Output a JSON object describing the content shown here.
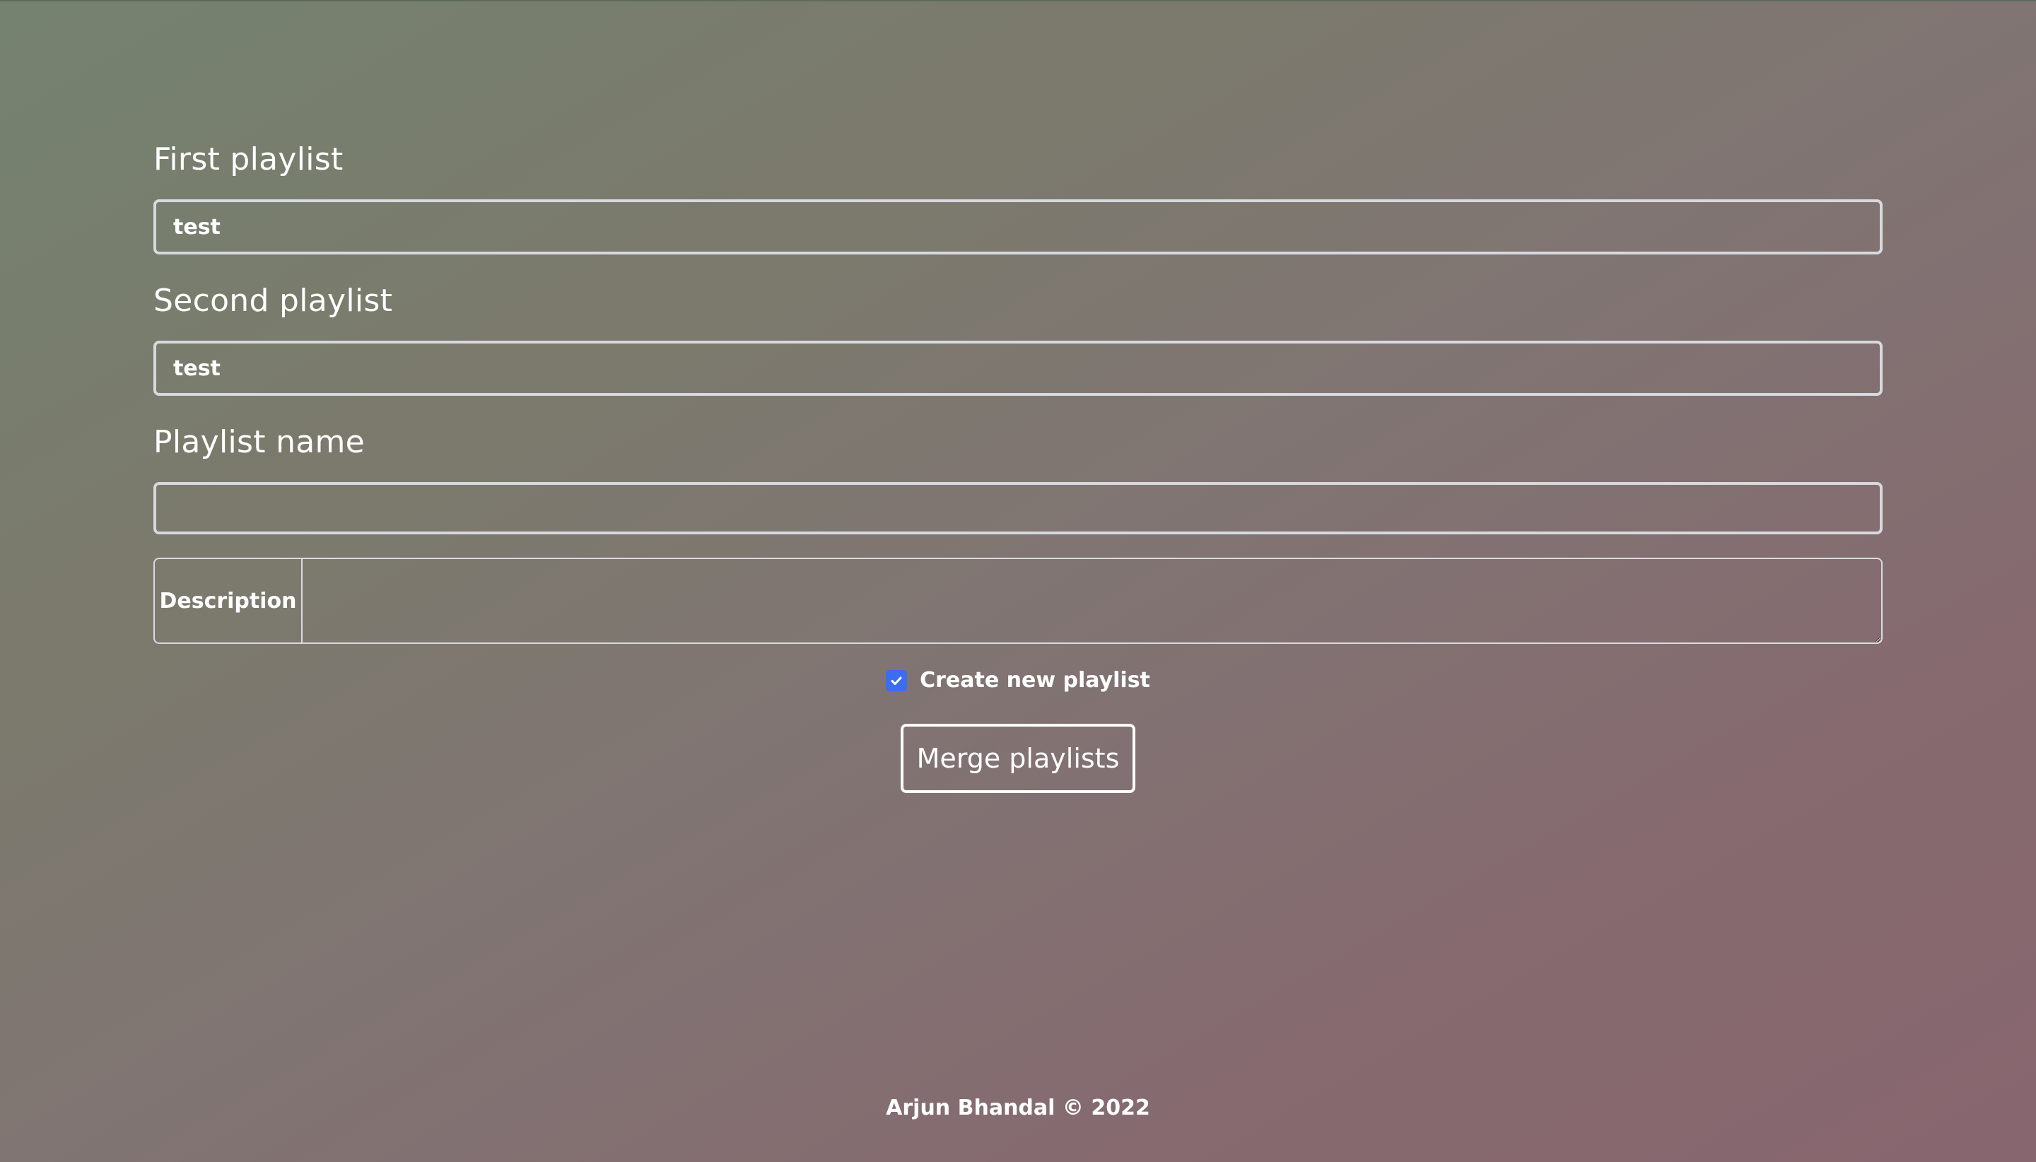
{
  "form": {
    "first_playlist": {
      "label": "First playlist",
      "value": "test"
    },
    "second_playlist": {
      "label": "Second playlist",
      "value": "test"
    },
    "playlist_name": {
      "label": "Playlist name",
      "value": ""
    },
    "description": {
      "label": "Description",
      "value": ""
    },
    "create_new_playlist": {
      "label": "Create new playlist",
      "checked": true
    },
    "merge_button_label": "Merge playlists"
  },
  "footer": {
    "text": "Arjun Bhandal © 2022"
  },
  "colors": {
    "checkbox_accent": "#3a6df0",
    "input_border": "#d7d9df"
  },
  "icons": {
    "checkbox_check": "check-icon"
  }
}
